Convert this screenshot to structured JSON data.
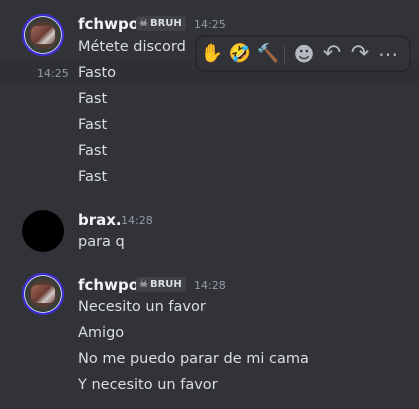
{
  "messages": [
    {
      "author": "fchwpo",
      "tag": "BRUH",
      "time": "14:25",
      "lines": [
        "Métete discord",
        "Fasto",
        "Fast",
        "Fast",
        "Fast",
        "Fast"
      ],
      "hover_time": "14:25"
    },
    {
      "author": "brax.",
      "time": "14:28",
      "lines": [
        "para q"
      ]
    },
    {
      "author": "fchwpo",
      "tag": "BRUH",
      "time": "14:28",
      "lines": [
        "Necesito un favor",
        "Amigo",
        "No me puedo parar de mi cama",
        "Y necesito un favor"
      ]
    }
  ],
  "toolbar": {
    "reactions": [
      {
        "icon": "raised-hand-emoji",
        "glyph": "✋"
      },
      {
        "icon": "rolling-laughing-emoji",
        "glyph": "🤣"
      },
      {
        "icon": "hammer-emoji",
        "glyph": "🔨"
      }
    ],
    "add_reaction_glyph": "☻",
    "reply_glyph": "↶",
    "forward_glyph": "↷",
    "more_glyph": "⋯"
  },
  "tag_icon_glyph": "☠"
}
